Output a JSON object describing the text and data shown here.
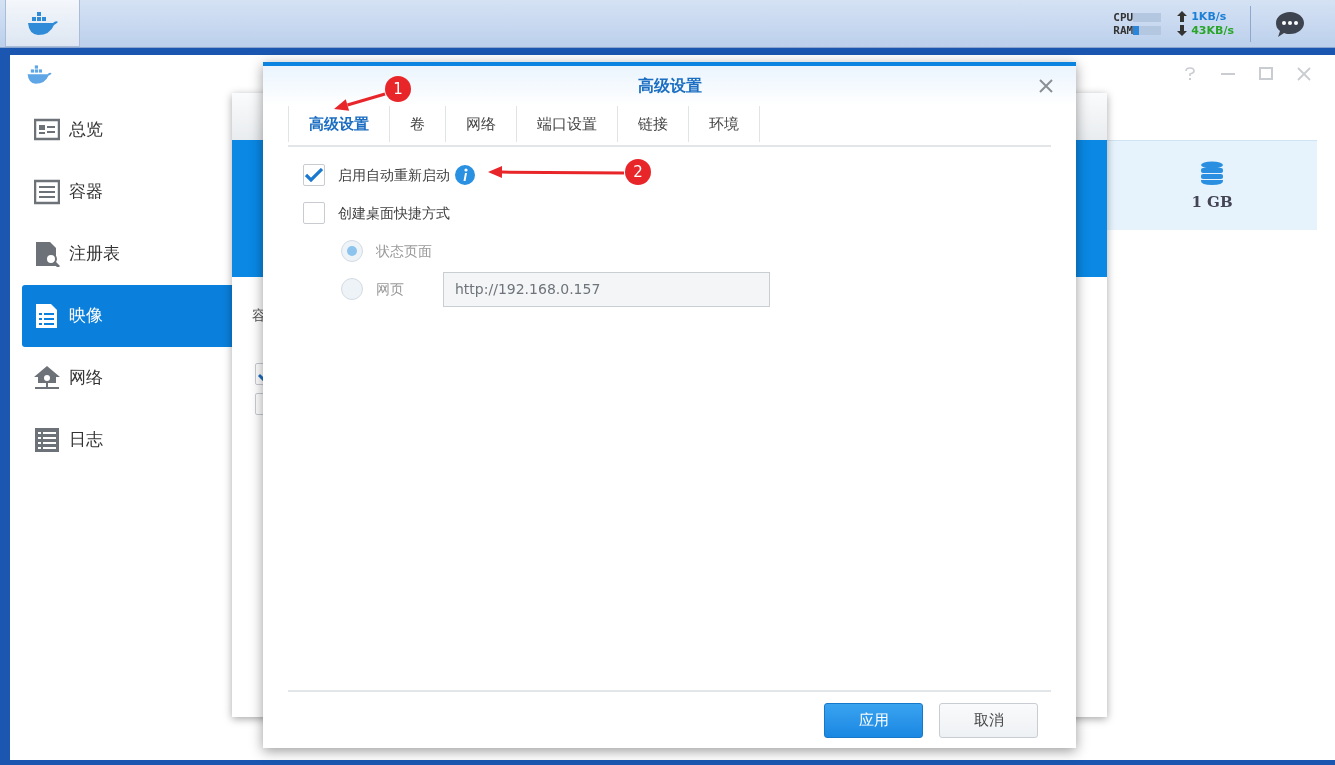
{
  "taskbar": {
    "meters": [
      {
        "label": "CPU",
        "level": 0.0
      },
      {
        "label": "RAM",
        "level": 0.2
      }
    ],
    "rates": [
      {
        "kind": "up",
        "value": "1KB/s"
      },
      {
        "kind": "down",
        "value": "43KB/s"
      }
    ]
  },
  "sidebar": {
    "items": [
      {
        "label": "总览",
        "kind": "overview",
        "selected": false
      },
      {
        "label": "容器",
        "kind": "container",
        "selected": false
      },
      {
        "label": "注册表",
        "kind": "registry",
        "selected": false
      },
      {
        "label": "映像",
        "kind": "image",
        "selected": true
      },
      {
        "label": "网络",
        "kind": "network",
        "selected": false
      },
      {
        "label": "日志",
        "kind": "log",
        "selected": false
      }
    ]
  },
  "storage": {
    "value": "1 GB"
  },
  "background_dialog": {
    "label": "容",
    "checkboxes": [
      {
        "checked": true
      },
      {
        "checked": false
      }
    ]
  },
  "dialog": {
    "title": "高级设置",
    "tabs": [
      {
        "label": "高级设置",
        "selected": true
      },
      {
        "label": "卷",
        "selected": false
      },
      {
        "label": "网络",
        "selected": false
      },
      {
        "label": "端口设置",
        "selected": false
      },
      {
        "label": "链接",
        "selected": false
      },
      {
        "label": "环境",
        "selected": false
      }
    ],
    "options": [
      {
        "kind": "checkbox",
        "label": "启用自动重新启动",
        "checked": true,
        "info": true
      },
      {
        "kind": "checkbox",
        "label": "创建桌面快捷方式",
        "checked": false
      },
      {
        "kind": "radio",
        "label": "状态页面",
        "selected": true,
        "disabled": true
      },
      {
        "kind": "radio",
        "label": "网页",
        "selected": false,
        "disabled": true,
        "value": "http://192.168.0.157"
      }
    ],
    "buttons": [
      {
        "label": "应用",
        "kind": "primary"
      },
      {
        "label": "取消",
        "kind": "secondary"
      }
    ]
  },
  "annotations": [
    {
      "label": "1"
    },
    {
      "label": "2"
    }
  ]
}
